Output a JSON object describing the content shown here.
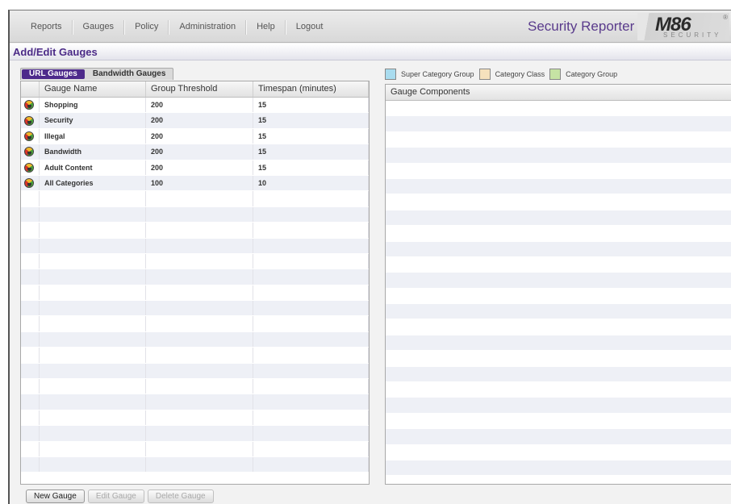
{
  "nav": {
    "items": [
      "Reports",
      "Gauges",
      "Policy",
      "Administration",
      "Help",
      "Logout"
    ]
  },
  "app_title": "Security Reporter",
  "logo": {
    "main": "M86",
    "sub": "SECURITY",
    "reg": "®"
  },
  "page_title": "Add/Edit Gauges",
  "tabs": {
    "url": "URL Gauges",
    "bandwidth": "Bandwidth Gauges"
  },
  "left_table": {
    "headers": [
      "Gauge Name",
      "Group Threshold",
      "Timespan (minutes)"
    ],
    "rows": [
      {
        "name": "Shopping",
        "threshold": "200",
        "timespan": "15"
      },
      {
        "name": "Security",
        "threshold": "200",
        "timespan": "15"
      },
      {
        "name": "Illegal",
        "threshold": "200",
        "timespan": "15"
      },
      {
        "name": "Bandwidth",
        "threshold": "200",
        "timespan": "15"
      },
      {
        "name": "Adult Content",
        "threshold": "200",
        "timespan": "15"
      },
      {
        "name": "All Categories",
        "threshold": "100",
        "timespan": "10"
      }
    ]
  },
  "legend": {
    "items": [
      {
        "label": "Super Category Group",
        "color": "#a9dcef"
      },
      {
        "label": "Category Class",
        "color": "#f5e1bd"
      },
      {
        "label": "Category Group",
        "color": "#c6e3a4"
      }
    ]
  },
  "right_table": {
    "header": "Gauge Components"
  },
  "buttons": {
    "new": "New Gauge",
    "edit": "Edit Gauge",
    "delete": "Delete Gauge"
  }
}
